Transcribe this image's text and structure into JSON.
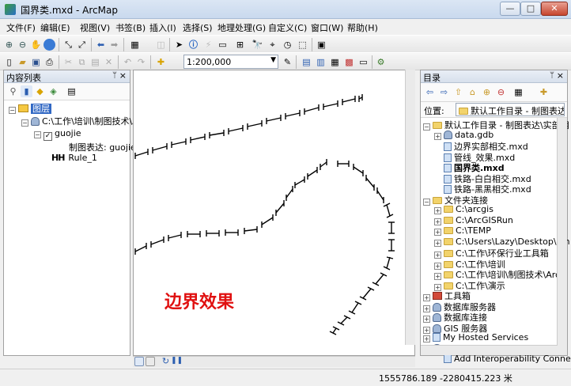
{
  "window": {
    "title": "国界类.mxd - ArcMap",
    "minimize_label": "—",
    "maximize_label": "□",
    "close_label": "✕"
  },
  "menu": [
    "文件(F)",
    "编辑(E)",
    "视图(V)",
    "书签(B)",
    "插入(I)",
    "选择(S)",
    "地理处理(G)",
    "自定义(C)",
    "窗口(W)",
    "帮助(H)"
  ],
  "toolbar": {
    "scale_value": "1:200,000"
  },
  "toc": {
    "title": "内容列表",
    "pin": "ᛘ",
    "close": "×",
    "layers_label": "图层",
    "folder_path": "C:\\工作\\培训\\制图技术\\A",
    "layer_name": "guojie",
    "representation_label": "制图表达: guojie",
    "rule_label": "Rule_1",
    "rule_symbol": "HH"
  },
  "map": {
    "annotation": "边界效果"
  },
  "catalog": {
    "title": "目录",
    "pin": "ᛘ",
    "close": "×",
    "location_label": "位置:",
    "location_value": "默认工作目录 - 制图表达\\",
    "items": [
      {
        "label": "默认工作目录 - 制图表达\\实部相",
        "icon": "folder-icon",
        "level": 0,
        "toggle": "−"
      },
      {
        "label": "data.gdb",
        "icon": "geodatabase-icon",
        "level": 1,
        "toggle": "+"
      },
      {
        "label": "边界实部相交.mxd",
        "icon": "map-document-icon",
        "level": 1,
        "toggle": ""
      },
      {
        "label": "管线_效果.mxd",
        "icon": "map-document-icon",
        "level": 1,
        "toggle": ""
      },
      {
        "label": "国界类.mxd",
        "icon": "map-document-icon",
        "level": 1,
        "toggle": "",
        "bold": true
      },
      {
        "label": "铁路-白白相交.mxd",
        "icon": "map-document-icon",
        "level": 1,
        "toggle": ""
      },
      {
        "label": "铁路-黑黑相交.mxd",
        "icon": "map-document-icon",
        "level": 1,
        "toggle": ""
      },
      {
        "label": "文件夹连接",
        "icon": "folder-icon",
        "level": 0,
        "toggle": "−"
      },
      {
        "label": "C:\\arcgis",
        "icon": "folder-icon",
        "level": 1,
        "toggle": "+"
      },
      {
        "label": "C:\\ArcGISRun",
        "icon": "folder-icon",
        "level": 1,
        "toggle": "+"
      },
      {
        "label": "C:\\TEMP",
        "icon": "folder-icon",
        "level": 1,
        "toggle": "+"
      },
      {
        "label": "C:\\Users\\Lazy\\Desktop\\km",
        "icon": "folder-icon",
        "level": 1,
        "toggle": "+"
      },
      {
        "label": "C:\\工作\\环保行业工具箱",
        "icon": "folder-icon",
        "level": 1,
        "toggle": "+"
      },
      {
        "label": "C:\\工作\\培训",
        "icon": "folder-icon",
        "level": 1,
        "toggle": "+"
      },
      {
        "label": "C:\\工作\\培训\\制图技术\\ArcG",
        "icon": "folder-icon",
        "level": 1,
        "toggle": "+"
      },
      {
        "label": "C:\\工作\\演示",
        "icon": "folder-icon",
        "level": 1,
        "toggle": "+"
      },
      {
        "label": "工具箱",
        "icon": "toolbox-icon",
        "level": 0,
        "toggle": "+"
      },
      {
        "label": "数据库服务器",
        "icon": "database-server-icon",
        "level": 0,
        "toggle": "+"
      },
      {
        "label": "数据库连接",
        "icon": "database-connection-icon",
        "level": 0,
        "toggle": "+"
      },
      {
        "label": "GIS 服务器",
        "icon": "gis-server-icon",
        "level": 0,
        "toggle": "+"
      },
      {
        "label": "My Hosted Services",
        "icon": "hosted-services-icon",
        "level": 0,
        "toggle": "+"
      },
      {
        "label": "Interoperability Connections",
        "icon": "interoperability-icon",
        "level": 0,
        "toggle": "−"
      },
      {
        "label": "Add Interoperability Conne",
        "icon": "add-connection-icon",
        "level": 1,
        "toggle": ""
      }
    ]
  },
  "status": {
    "coordinates": "1555786.189  -2280415.223 米"
  }
}
